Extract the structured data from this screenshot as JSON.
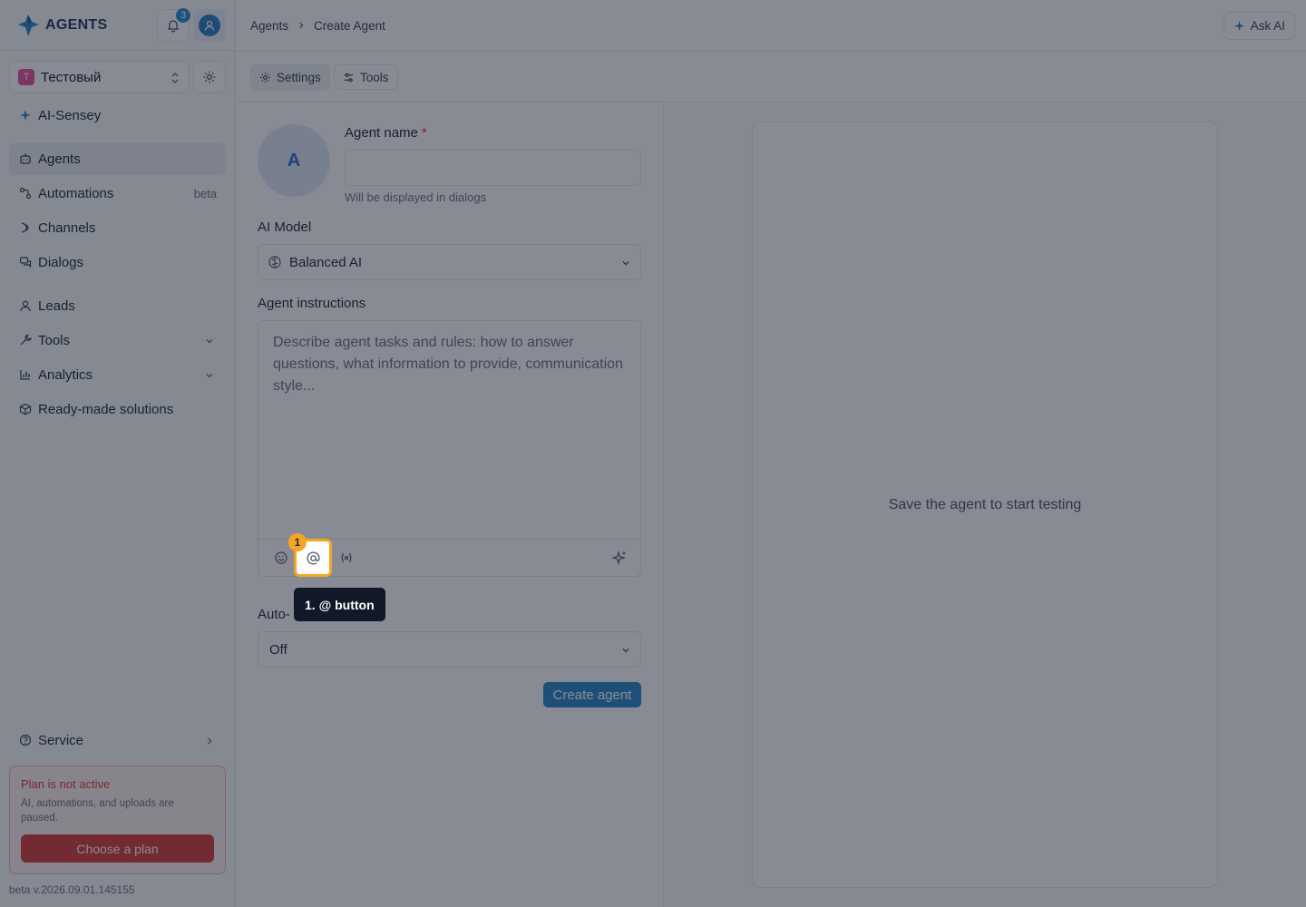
{
  "app": {
    "logo_text": "AGENTS",
    "notification_count": "3"
  },
  "workspace": {
    "avatar_letter": "T",
    "name": "Тестовый"
  },
  "sidebar": {
    "items": [
      {
        "label": "AI-Sensey",
        "icon": "sparkle-icon"
      },
      {
        "label": "Agents",
        "icon": "bot-icon",
        "active": true
      },
      {
        "label": "Automations",
        "icon": "workflow-icon",
        "extra": "beta"
      },
      {
        "label": "Channels",
        "icon": "channels-icon"
      },
      {
        "label": "Dialogs",
        "icon": "chat-icon"
      },
      {
        "label": "Leads",
        "icon": "user-icon"
      },
      {
        "label": "Tools",
        "icon": "wrench-icon"
      },
      {
        "label": "Analytics",
        "icon": "bar-chart-icon"
      },
      {
        "label": "Ready-made solutions",
        "icon": "package-icon"
      }
    ],
    "service_label": "Service",
    "plan": {
      "title": "Plan is not active",
      "description": "AI, automations, and uploads are paused.",
      "button": "Choose a plan"
    },
    "version": "beta v.2026.09.01.145155"
  },
  "header": {
    "breadcrumb": [
      "Agents",
      "Create Agent"
    ],
    "ask_ai": "Ask AI"
  },
  "tabs": [
    {
      "label": "Settings",
      "icon": "gear-icon",
      "active": true
    },
    {
      "label": "Tools",
      "icon": "sliders-icon",
      "active": false
    }
  ],
  "form": {
    "avatar_letter": "A",
    "agent_name_label": "Agent name",
    "required_mark": "*",
    "agent_name_value": "",
    "agent_name_hint": "Will be displayed in dialogs",
    "model_label": "AI Model",
    "model_value": "Balanced AI",
    "instructions_label": "Agent instructions",
    "instructions_placeholder": "Describe agent tasks and rules: how to answer questions, what information to provide, communication style...",
    "auto_label": "Auto-",
    "auto_value": "Off",
    "create_button": "Create agent"
  },
  "preview": {
    "message": "Save the agent to start testing"
  },
  "highlight": {
    "badge": "1",
    "tooltip": "1. @ button",
    "target_symbol": "@"
  },
  "colors": {
    "accent": "#2b86c9",
    "danger": "#d73d3d",
    "highlight": "#f5a524",
    "overlay": "rgba(17,24,39,0.5)"
  }
}
